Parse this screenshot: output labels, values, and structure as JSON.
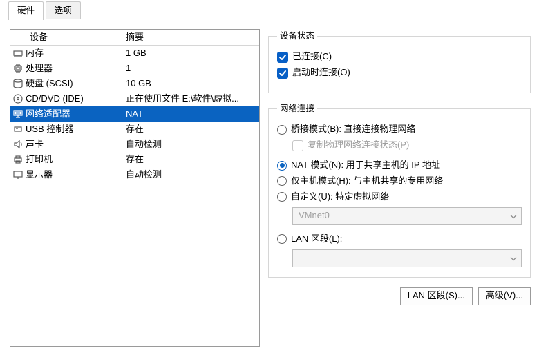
{
  "tabs": {
    "hardware": "硬件",
    "options": "选项"
  },
  "list": {
    "header_device": "设备",
    "header_summary": "摘要",
    "items": [
      {
        "icon": "memory-icon",
        "name": "内存",
        "summary": "1 GB"
      },
      {
        "icon": "cpu-icon",
        "name": "处理器",
        "summary": "1"
      },
      {
        "icon": "disk-icon",
        "name": "硬盘 (SCSI)",
        "summary": "10 GB"
      },
      {
        "icon": "optical-icon",
        "name": "CD/DVD (IDE)",
        "summary": "正在使用文件 E:\\软件\\虚拟..."
      },
      {
        "icon": "network-icon",
        "name": "网络适配器",
        "summary": "NAT"
      },
      {
        "icon": "usb-icon",
        "name": "USB 控制器",
        "summary": "存在"
      },
      {
        "icon": "sound-icon",
        "name": "声卡",
        "summary": "自动检测"
      },
      {
        "icon": "printer-icon",
        "name": "打印机",
        "summary": "存在"
      },
      {
        "icon": "display-icon",
        "name": "显示器",
        "summary": "自动检测"
      }
    ],
    "selected_index": 4
  },
  "device_status": {
    "legend": "设备状态",
    "connected_label": "已连接(C)",
    "connected_checked": true,
    "connect_at_power_on_label": "启动时连接(O)",
    "connect_at_power_on_checked": true
  },
  "network": {
    "legend": "网络连接",
    "bridged_label": "桥接模式(B): 直接连接物理网络",
    "replicate_state_label": "复制物理网络连接状态(P)",
    "nat_label": "NAT 模式(N): 用于共享主机的 IP 地址",
    "hostonly_label": "仅主机模式(H): 与主机共享的专用网络",
    "custom_label": "自定义(U): 特定虚拟网络",
    "custom_combo_value": "VMnet0",
    "lan_segment_label": "LAN 区段(L):",
    "lan_combo_value": "",
    "selected": "nat"
  },
  "buttons": {
    "lan_segments": "LAN 区段(S)...",
    "advanced": "高级(V)..."
  }
}
